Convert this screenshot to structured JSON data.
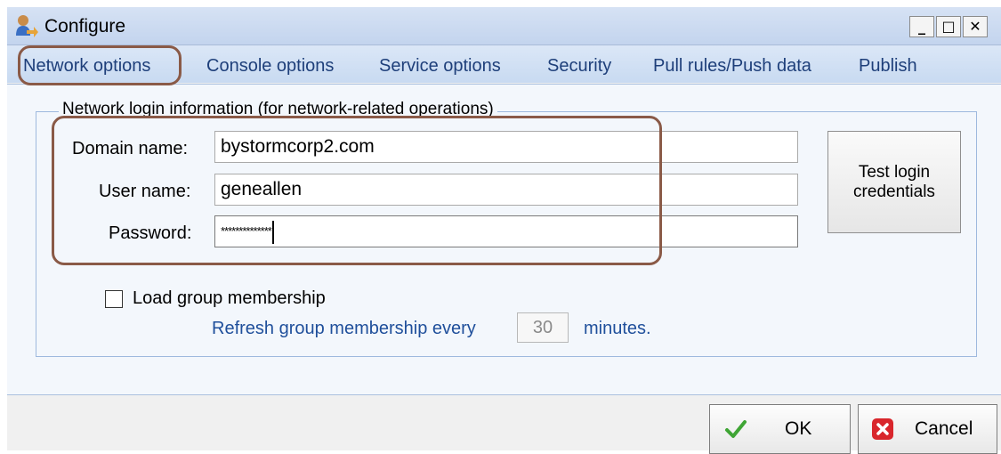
{
  "window": {
    "title": "Configure",
    "controls": {
      "minimize": "_",
      "maximize": "□",
      "close": "✕"
    }
  },
  "tabs": [
    {
      "label": "Network options",
      "active": true
    },
    {
      "label": "Console options"
    },
    {
      "label": "Service options"
    },
    {
      "label": "Security"
    },
    {
      "label": "Pull rules/Push data"
    },
    {
      "label": "Publish"
    }
  ],
  "group": {
    "legend": "Network login information (for network-related operations)"
  },
  "form": {
    "domain_label": "Domain name:",
    "domain_value": "bystormcorp2.com",
    "user_label": "User name:",
    "user_value": "geneallen",
    "password_label": "Password:",
    "password_value": "**************"
  },
  "test_button": {
    "line1": "Test login",
    "line2": "credentials"
  },
  "membership": {
    "checkbox_label": "Load group membership",
    "checked": false,
    "refresh_prefix": "Refresh group membership every",
    "refresh_value": "30",
    "refresh_suffix": "minutes."
  },
  "footer": {
    "ok_label": "OK",
    "cancel_label": "Cancel"
  },
  "colors": {
    "highlight": "#8a5a47",
    "ok_check": "#3fa535",
    "cancel_red": "#d9262c",
    "link_blue": "#1f4f9b"
  },
  "icons": [
    "configure-app-icon",
    "checkmark-icon",
    "cancel-x-icon"
  ]
}
